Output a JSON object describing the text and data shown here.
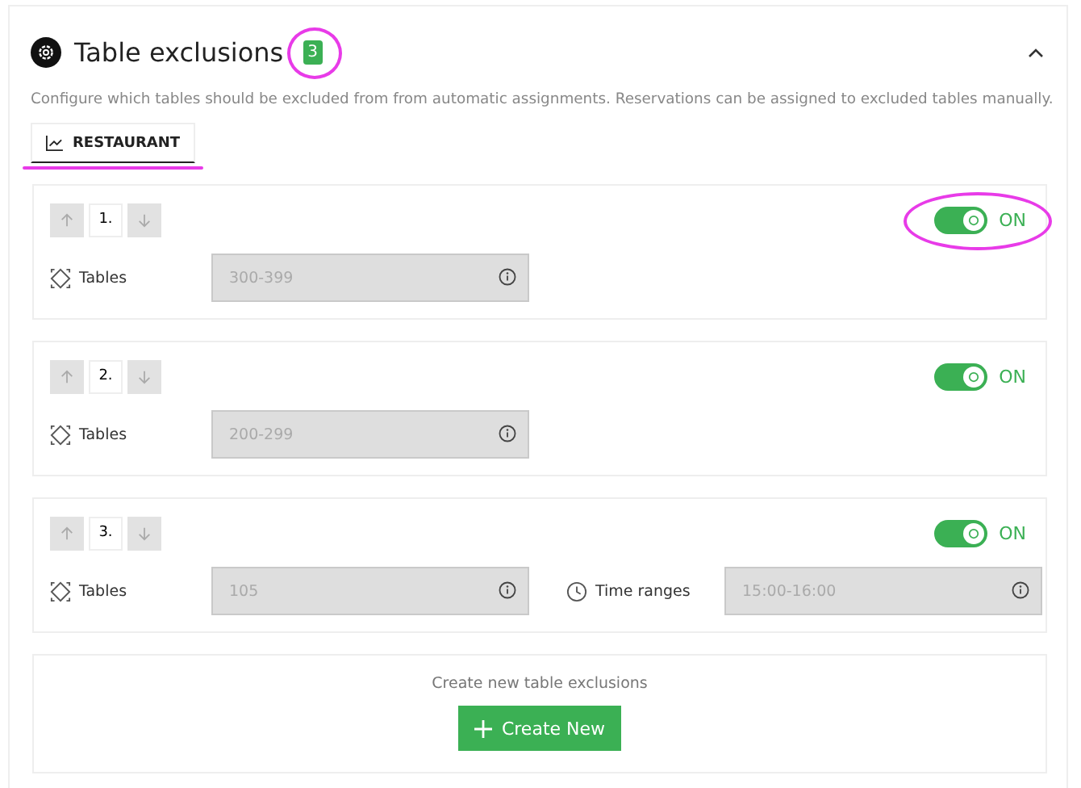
{
  "section": {
    "title": "Table exclusions",
    "count": "3",
    "count_highlighted": true,
    "expanded": true,
    "description": "Configure which tables should be excluded from from automatic assignments. Reservations can be assigned to excluded tables manually."
  },
  "tabs": [
    {
      "label": "RESTAURANT",
      "selected": true,
      "highlighted": true
    }
  ],
  "exclusions": [
    {
      "order": "1.",
      "on": true,
      "toggle_label": "ON",
      "highlighted": true,
      "fields": [
        {
          "kind": "tables",
          "label": "Tables",
          "placeholder": "300-399"
        }
      ]
    },
    {
      "order": "2.",
      "on": true,
      "toggle_label": "ON",
      "highlighted": false,
      "fields": [
        {
          "kind": "tables",
          "label": "Tables",
          "placeholder": "200-299"
        }
      ]
    },
    {
      "order": "3.",
      "on": true,
      "toggle_label": "ON",
      "highlighted": false,
      "fields": [
        {
          "kind": "tables",
          "label": "Tables",
          "placeholder": "105"
        },
        {
          "kind": "time",
          "label": "Time ranges",
          "placeholder": "15:00-16:00"
        }
      ]
    }
  ],
  "create": {
    "prompt": "Create new table exclusions",
    "button": "Create New"
  }
}
